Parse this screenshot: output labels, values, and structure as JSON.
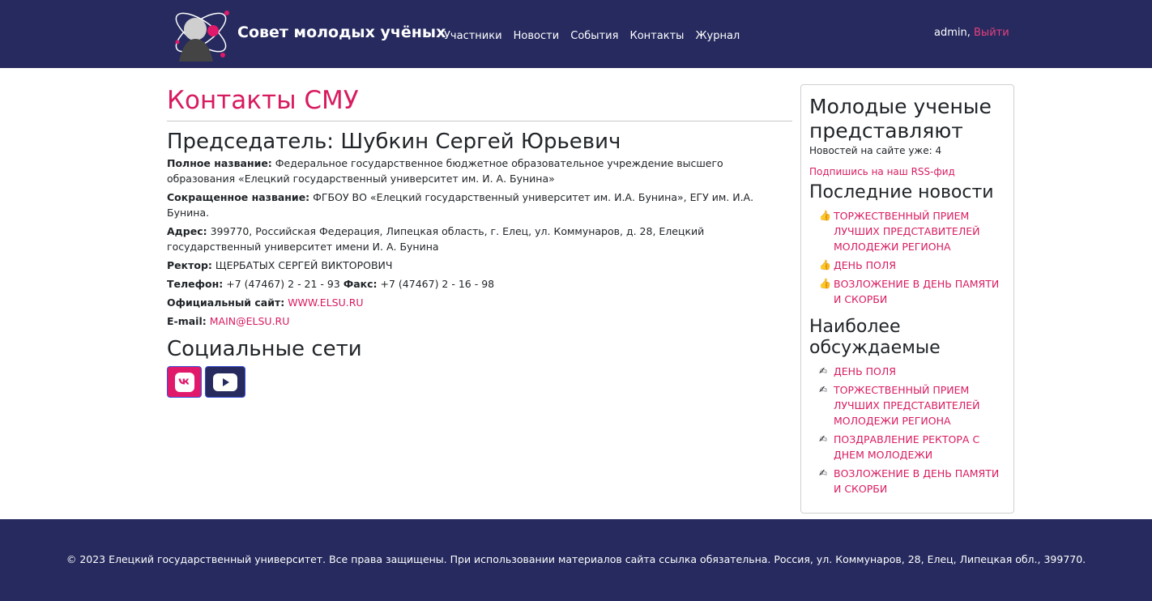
{
  "header": {
    "brand": "Совет молодых учёных",
    "nav": [
      "Участники",
      "Новости",
      "События",
      "Контакты",
      "Журнал"
    ],
    "user": "admin,",
    "logout": "Выйти",
    "accent": "#262a5e"
  },
  "main": {
    "title": "Контакты СМУ",
    "chairman": "Председатель: Шубкин Сергей Юрьевич",
    "fields": [
      {
        "label": "Полное название:",
        "value": "Федеральное государственное бюджетное образовательное учреждение высшего образования «Елецкий государственный университет им. И. А. Бунина»"
      },
      {
        "label": "Сокращенное название:",
        "value": "ФГБОУ ВО «Елецкий государственный университет им. И.А. Бунина», ЕГУ им. И.А. Бунина."
      },
      {
        "label": "Адрес:",
        "value": "399770, Российская Федерация, Липецкая область, г. Елец, ул. Коммунаров, д. 28, Елецкий государственный университет имени И. А. Бунина"
      },
      {
        "label": "Ректор:",
        "value": "ЩЕРБАТЫХ СЕРГЕЙ ВИКТОРОВИЧ"
      }
    ],
    "phone_label": "Телефон:",
    "phone": "+7 (47467) 2 - 21 - 93",
    "fax_label": "Факс:",
    "fax": "+7 (47467) 2 - 16 - 98",
    "site_label": "Официальный сайт:",
    "site": "WWW.ELSU.RU",
    "email_label": "E-mail:",
    "email": "MAIN@ELSU.RU",
    "social_title": "Социальные сети",
    "social_icons": [
      "vk-icon",
      "youtube-icon"
    ]
  },
  "sidebar": {
    "title": "Молодые ученые представляют",
    "news_count": "Новостей на сайте уже: 4",
    "rss": "Подпишись на наш RSS-фид",
    "latest_title": "Последние новости",
    "latest": [
      "ТОРЖЕСТВЕННЫЙ ПРИЕМ ЛУЧШИХ ПРЕДСТАВИТЕЛЕЙ МОЛОДЕЖИ РЕГИОНА",
      "ДЕНЬ ПОЛЯ",
      "ВОЗЛОЖЕНИЕ В ДЕНЬ ПАМЯТИ И СКОРБИ"
    ],
    "discussed_title": "Наиболее обсуждаемые",
    "discussed": [
      "ДЕНЬ ПОЛЯ",
      "ТОРЖЕСТВЕННЫЙ ПРИЕМ ЛУЧШИХ ПРЕДСТАВИТЕЛЕЙ МОЛОДЕЖИ РЕГИОНА",
      "ПОЗДРАВЛЕНИЕ РЕКТОРА С ДНЕМ МОЛОДЕЖИ",
      "ВОЗЛОЖЕНИЕ В ДЕНЬ ПАМЯТИ И СКОРБИ"
    ]
  },
  "footer": {
    "text": "© 2023 Елецкий государственный университет. Все права защищены. При использовании материалов сайта ссылка обязательна. Россия, ул. Коммунаров, 28, Елец, Липецкая обл., 399770."
  }
}
